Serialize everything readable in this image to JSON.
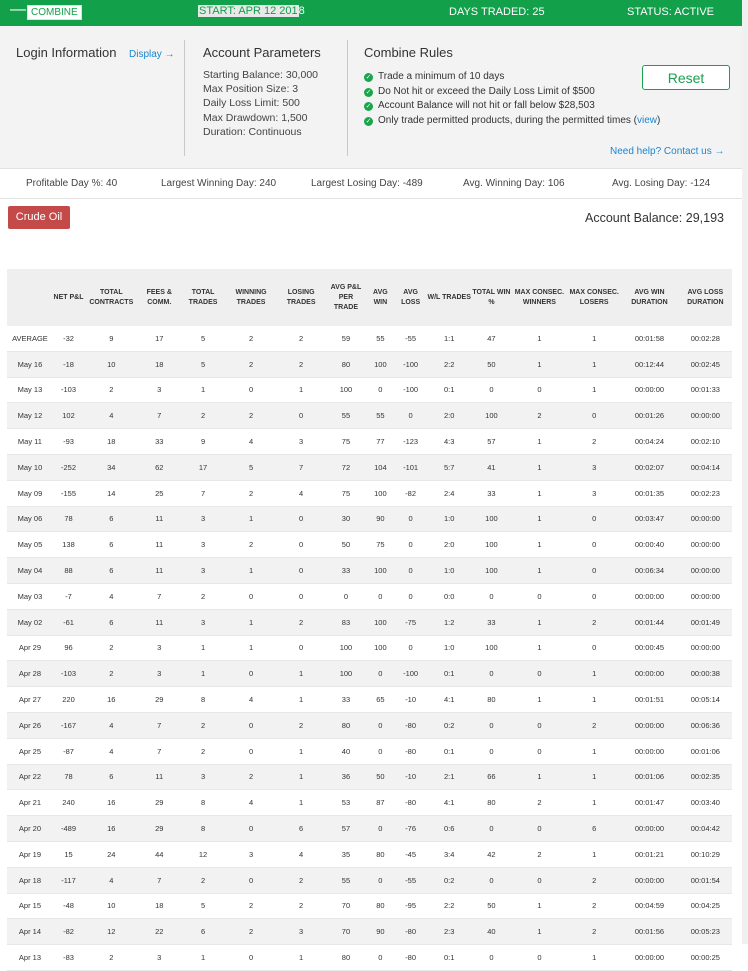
{
  "topbar": {
    "minus": "—",
    "combine": "COMBINE",
    "start_prefix": "START: APR 12 201",
    "start_suffix": "8",
    "days_traded": "DAYS TRADED: 25",
    "status": "STATUS: ACTIVE"
  },
  "login": {
    "title": "Login Information",
    "display_link": "Display →"
  },
  "params": {
    "title": "Account Parameters",
    "items": [
      "Starting Balance: 30,000",
      "Max Position Size: 3",
      "Daily Loss Limit: 500",
      "Max Drawdown: 1,500",
      "Duration: Continuous"
    ]
  },
  "rules": {
    "title": "Combine Rules",
    "items": [
      "Trade a minimum of 10 days",
      "Do Not hit or exceed the Daily Loss Limit of $500",
      "Account Balance will not hit or fall below $28,503",
      "Only trade permitted products, during the permitted times"
    ],
    "view_link": "view",
    "help_link": "Need help? Contact us →",
    "reset_label": "Reset"
  },
  "stats": {
    "profitable": "Profitable Day %: 40",
    "largest_win": "Largest Winning Day: 240",
    "largest_loss": "Largest Losing Day: -489",
    "avg_win": "Avg. Winning Day: 106",
    "avg_loss": "Avg. Losing Day: -124"
  },
  "product_button": "Crude Oil",
  "account_balance": "Account Balance: 29,193",
  "table": {
    "headers": [
      "",
      "NET P&L",
      "TOTAL CONTRACTS",
      "FEES & COMM.",
      "TOTAL TRADES",
      "WINNING TRADES",
      "LOSING TRADES",
      "AVG P&L PER TRADE",
      "AVG WIN",
      "AVG LOSS",
      "W/L TRADES",
      "TOTAL WIN %",
      "MAX CONSEC. WINNERS",
      "MAX CONSEC. LOSERS",
      "AVG WIN DURATION",
      "AVG LOSS DURATION"
    ],
    "rows": [
      [
        "AVERAGE",
        "-32",
        "9",
        "17",
        "5",
        "2",
        "2",
        "59",
        "55",
        "-55",
        "1:1",
        "47",
        "1",
        "1",
        "00:01:58",
        "00:02:28"
      ],
      [
        "May 16",
        "-18",
        "10",
        "18",
        "5",
        "2",
        "2",
        "80",
        "100",
        "-100",
        "2:2",
        "50",
        "1",
        "1",
        "00:12:44",
        "00:02:45"
      ],
      [
        "May 13",
        "-103",
        "2",
        "3",
        "1",
        "0",
        "1",
        "100",
        "0",
        "-100",
        "0:1",
        "0",
        "0",
        "1",
        "00:00:00",
        "00:01:33"
      ],
      [
        "May 12",
        "102",
        "4",
        "7",
        "2",
        "2",
        "0",
        "55",
        "55",
        "0",
        "2:0",
        "100",
        "2",
        "0",
        "00:01:26",
        "00:00:00"
      ],
      [
        "May 11",
        "-93",
        "18",
        "33",
        "9",
        "4",
        "3",
        "75",
        "77",
        "-123",
        "4:3",
        "57",
        "1",
        "2",
        "00:04:24",
        "00:02:10"
      ],
      [
        "May 10",
        "-252",
        "34",
        "62",
        "17",
        "5",
        "7",
        "72",
        "104",
        "-101",
        "5:7",
        "41",
        "1",
        "3",
        "00:02:07",
        "00:04:14"
      ],
      [
        "May 09",
        "-155",
        "14",
        "25",
        "7",
        "2",
        "4",
        "75",
        "100",
        "-82",
        "2:4",
        "33",
        "1",
        "3",
        "00:01:35",
        "00:02:23"
      ],
      [
        "May 06",
        "78",
        "6",
        "11",
        "3",
        "1",
        "0",
        "30",
        "90",
        "0",
        "1:0",
        "100",
        "1",
        "0",
        "00:03:47",
        "00:00:00"
      ],
      [
        "May 05",
        "138",
        "6",
        "11",
        "3",
        "2",
        "0",
        "50",
        "75",
        "0",
        "2:0",
        "100",
        "1",
        "0",
        "00:00:40",
        "00:00:00"
      ],
      [
        "May 04",
        "88",
        "6",
        "11",
        "3",
        "1",
        "0",
        "33",
        "100",
        "0",
        "1:0",
        "100",
        "1",
        "0",
        "00:06:34",
        "00:00:00"
      ],
      [
        "May 03",
        "-7",
        "4",
        "7",
        "2",
        "0",
        "0",
        "0",
        "0",
        "0",
        "0:0",
        "0",
        "0",
        "0",
        "00:00:00",
        "00:00:00"
      ],
      [
        "May 02",
        "-61",
        "6",
        "11",
        "3",
        "1",
        "2",
        "83",
        "100",
        "-75",
        "1:2",
        "33",
        "1",
        "2",
        "00:01:44",
        "00:01:49"
      ],
      [
        "Apr 29",
        "96",
        "2",
        "3",
        "1",
        "1",
        "0",
        "100",
        "100",
        "0",
        "1:0",
        "100",
        "1",
        "0",
        "00:00:45",
        "00:00:00"
      ],
      [
        "Apr 28",
        "-103",
        "2",
        "3",
        "1",
        "0",
        "1",
        "100",
        "0",
        "-100",
        "0:1",
        "0",
        "0",
        "1",
        "00:00:00",
        "00:00:38"
      ],
      [
        "Apr 27",
        "220",
        "16",
        "29",
        "8",
        "4",
        "1",
        "33",
        "65",
        "-10",
        "4:1",
        "80",
        "1",
        "1",
        "00:01:51",
        "00:05:14"
      ],
      [
        "Apr 26",
        "-167",
        "4",
        "7",
        "2",
        "0",
        "2",
        "80",
        "0",
        "-80",
        "0:2",
        "0",
        "0",
        "2",
        "00:00:00",
        "00:06:36"
      ],
      [
        "Apr 25",
        "-87",
        "4",
        "7",
        "2",
        "0",
        "1",
        "40",
        "0",
        "-80",
        "0:1",
        "0",
        "0",
        "1",
        "00:00:00",
        "00:01:06"
      ],
      [
        "Apr 22",
        "78",
        "6",
        "11",
        "3",
        "2",
        "1",
        "36",
        "50",
        "-10",
        "2:1",
        "66",
        "1",
        "1",
        "00:01:06",
        "00:02:35"
      ],
      [
        "Apr 21",
        "240",
        "16",
        "29",
        "8",
        "4",
        "1",
        "53",
        "87",
        "-80",
        "4:1",
        "80",
        "2",
        "1",
        "00:01:47",
        "00:03:40"
      ],
      [
        "Apr 20",
        "-489",
        "16",
        "29",
        "8",
        "0",
        "6",
        "57",
        "0",
        "-76",
        "0:6",
        "0",
        "0",
        "6",
        "00:00:00",
        "00:04:42"
      ],
      [
        "Apr 19",
        "15",
        "24",
        "44",
        "12",
        "3",
        "4",
        "35",
        "80",
        "-45",
        "3:4",
        "42",
        "2",
        "1",
        "00:01:21",
        "00:10:29"
      ],
      [
        "Apr 18",
        "-117",
        "4",
        "7",
        "2",
        "0",
        "2",
        "55",
        "0",
        "-55",
        "0:2",
        "0",
        "0",
        "2",
        "00:00:00",
        "00:01:54"
      ],
      [
        "Apr 15",
        "-48",
        "10",
        "18",
        "5",
        "2",
        "2",
        "70",
        "80",
        "-95",
        "2:2",
        "50",
        "1",
        "2",
        "00:04:59",
        "00:04:25"
      ],
      [
        "Apr 14",
        "-82",
        "12",
        "22",
        "6",
        "2",
        "3",
        "70",
        "90",
        "-80",
        "2:3",
        "40",
        "1",
        "2",
        "00:01:56",
        "00:05:23"
      ],
      [
        "Apr 13",
        "-83",
        "2",
        "3",
        "1",
        "0",
        "1",
        "80",
        "0",
        "-80",
        "0:1",
        "0",
        "0",
        "1",
        "00:00:00",
        "00:00:25"
      ]
    ]
  },
  "colors": {
    "brand_green": "#12a04a",
    "danger_red": "#c44a4a",
    "link_blue": "#1a86d0"
  }
}
